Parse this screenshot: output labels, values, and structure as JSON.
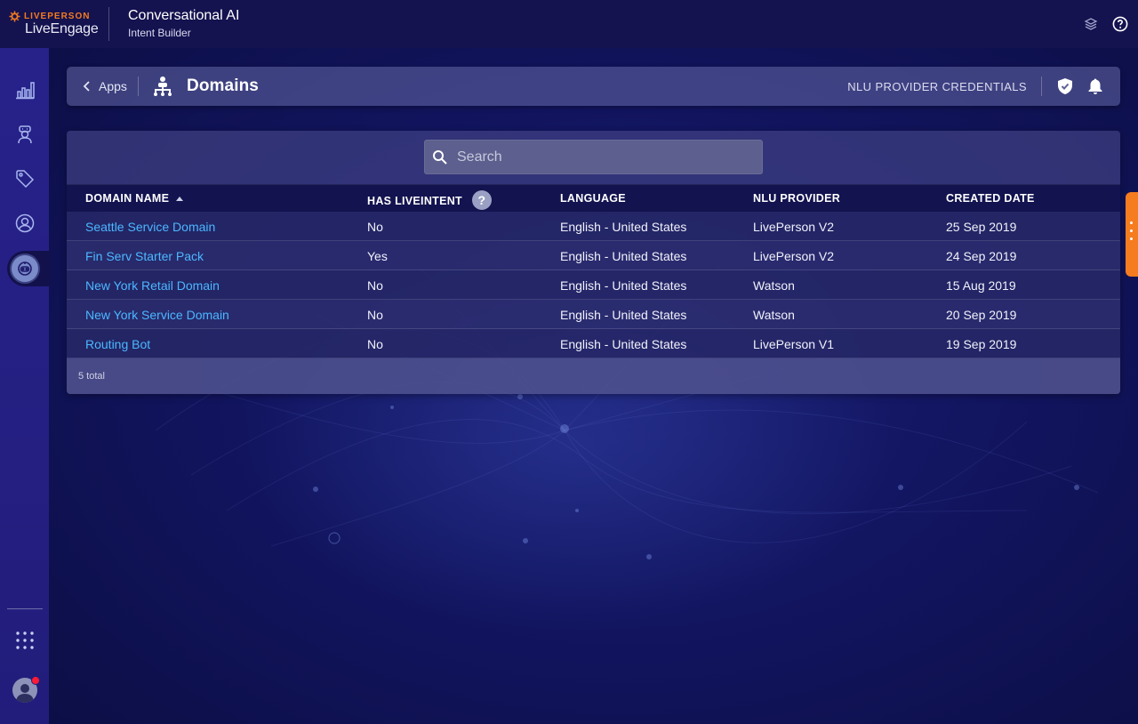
{
  "brand": {
    "top": "LIVEPERSON",
    "name": "LiveEngage"
  },
  "app": {
    "title": "Conversational AI",
    "subtitle": "Intent Builder"
  },
  "topbar": {
    "icons": [
      "layers-icon",
      "help-icon"
    ]
  },
  "rail": {
    "items": [
      {
        "name": "analytics",
        "icon": "bar-chart-icon"
      },
      {
        "name": "agents",
        "icon": "agent-icon"
      },
      {
        "name": "tags",
        "icon": "tag-icon"
      },
      {
        "name": "users",
        "icon": "user-circle-icon"
      },
      {
        "name": "conversational-ai",
        "icon": "bot-icon",
        "active": true
      }
    ],
    "bottom": [
      "apps-grid-icon",
      "user-avatar"
    ],
    "notification_color": "#ff1a35"
  },
  "header": {
    "back_label": "Apps",
    "title": "Domains",
    "nlu_link": "NLU PROVIDER CREDENTIALS",
    "icons": [
      "shield-icon",
      "bell-icon"
    ]
  },
  "search": {
    "placeholder": "Search",
    "value": ""
  },
  "table": {
    "columns": [
      "DOMAIN NAME",
      "HAS LIVEINTENT",
      "LANGUAGE",
      "NLU PROVIDER",
      "CREATED DATE"
    ],
    "sort": {
      "column": "DOMAIN NAME",
      "direction": "asc"
    },
    "help_glyph": "?",
    "rows": [
      {
        "name": "Seattle Service Domain",
        "liveintent": "No",
        "language": "English - United States",
        "provider": "LivePerson V2",
        "date": "25 Sep 2019"
      },
      {
        "name": "Fin Serv Starter Pack",
        "liveintent": "Yes",
        "language": "English - United States",
        "provider": "LivePerson V2",
        "date": "24 Sep 2019"
      },
      {
        "name": "New York Retail Domain",
        "liveintent": "No",
        "language": "English - United States",
        "provider": "Watson",
        "date": "15 Aug 2019"
      },
      {
        "name": "New York Service Domain",
        "liveintent": "No",
        "language": "English - United States",
        "provider": "Watson",
        "date": "20 Sep 2019"
      },
      {
        "name": "Routing Bot",
        "liveintent": "No",
        "language": "English - United States",
        "provider": "LivePerson V1",
        "date": "19 Sep 2019"
      }
    ],
    "total": "5 total"
  },
  "colors": {
    "accent": "#f57c1f",
    "link": "#4cb7ff",
    "brand_orange": "#f47b20"
  }
}
